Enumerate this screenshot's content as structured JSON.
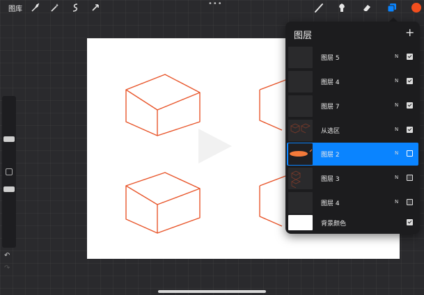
{
  "app": {
    "gallery_label": "图库",
    "accent_color": "#0a84ff",
    "brush_color": "#f24e1e"
  },
  "toolbar": {
    "left_tools": [
      "wrench-icon",
      "magic-wand-icon",
      "selection-icon",
      "transform-arrow-icon"
    ],
    "right_tools": [
      "brush-icon",
      "smudge-icon",
      "eraser-icon",
      "layers-icon"
    ],
    "menu_dots": "•••"
  },
  "sidebar": {
    "undo_label": "↶",
    "redo_label": "↷"
  },
  "layers_panel": {
    "title": "图层",
    "add_label": "+",
    "layers": [
      {
        "name": "图层 5",
        "mode": "N",
        "visible": true,
        "active": false
      },
      {
        "name": "图层 4",
        "mode": "N",
        "visible": true,
        "active": false
      },
      {
        "name": "图层 7",
        "mode": "N",
        "visible": true,
        "active": false
      },
      {
        "name": "从选区",
        "mode": "N",
        "visible": true,
        "active": false
      },
      {
        "name": "图层 2",
        "mode": "N",
        "visible": false,
        "active": true
      },
      {
        "name": "图层 3",
        "mode": "N",
        "visible": false,
        "active": false
      },
      {
        "name": "图层 4",
        "mode": "N",
        "visible": false,
        "active": false
      },
      {
        "name": "背景颜色",
        "mode": "",
        "visible": true,
        "active": false
      }
    ]
  }
}
